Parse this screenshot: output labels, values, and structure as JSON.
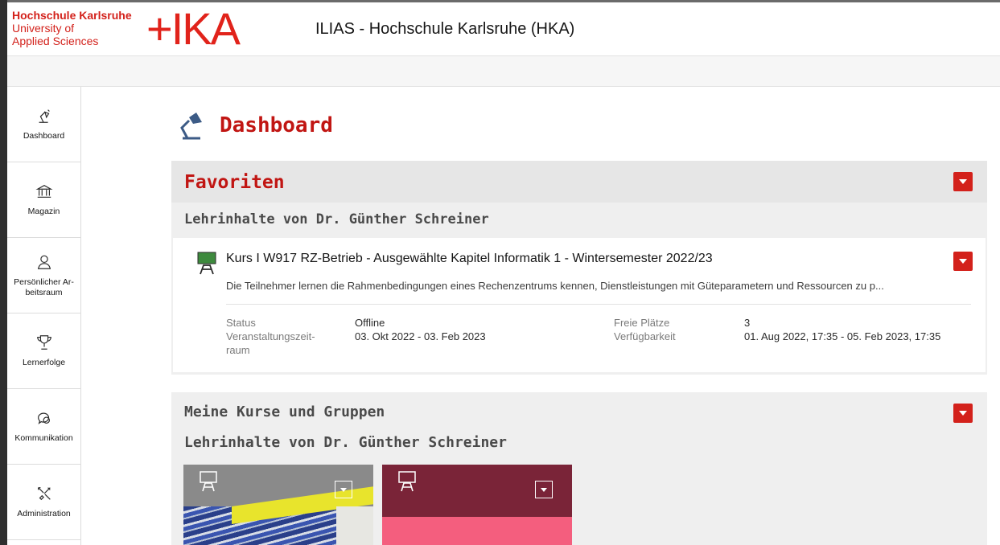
{
  "header": {
    "brand_line1": "Hochschule Karlsruhe",
    "brand_line2": "University of",
    "brand_line3": "Applied Sciences",
    "logo": "+IKA",
    "title": "ILIAS - Hochschule Karlsruhe (HKA)"
  },
  "sidebar": {
    "items": [
      {
        "label": "Dashboard",
        "icon": "desk-lamp-icon"
      },
      {
        "label": "Magazin",
        "icon": "bank-icon"
      },
      {
        "label": "Persönlicher Ar-beitsraum",
        "icon": "person-icon"
      },
      {
        "label": "Lernerfolge",
        "icon": "trophy-icon"
      },
      {
        "label": "Kommunikation",
        "icon": "chat-bubbles-icon"
      },
      {
        "label": "Administration",
        "icon": "tools-icon"
      }
    ]
  },
  "page": {
    "title": "Dashboard"
  },
  "favoriten": {
    "title": "Favoriten",
    "subtitle": "Lehrinhalte von Dr. Günther Schreiner",
    "item": {
      "title": "Kurs I W917 RZ-Betrieb - Ausgewählte Kapitel Informatik 1 - Wintersemester 2022/23",
      "description": "Die Teilnehmer lernen die Rahmenbedingungen eines Rechenzentrums kennen, Dienstleistungen mit Güteparametern und Ressourcen zu p...",
      "props": {
        "status_label": "Status",
        "status_value": "Offline",
        "period_label": "Veranstaltungszeit-\nraum",
        "period_value": "03. Okt 2022 - 03. Feb 2023",
        "free_label": "Freie Plätze",
        "free_value": "3",
        "avail_label": "Verfügbarkeit",
        "avail_value": "01. Aug 2022, 17:35 - 05. Feb 2023, 17:35"
      }
    }
  },
  "kurse": {
    "title": "Meine Kurse und Gruppen",
    "subtitle": "Lehrinhalte von Dr. Günther Schreiner"
  },
  "colors": {
    "accent": "#d3211b",
    "title_red": "#c11613",
    "tile_b_top": "#7a2438",
    "tile_b_bottom": "#f45e7e"
  }
}
